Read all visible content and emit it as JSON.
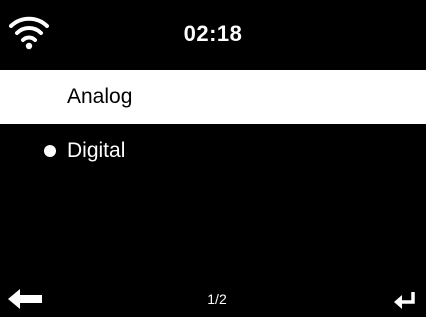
{
  "status_bar": {
    "time": "02:18",
    "wifi_icon": "wifi-icon"
  },
  "menu": {
    "items": [
      {
        "label": "Analog",
        "selected": true
      },
      {
        "label": "Digital",
        "selected": false,
        "radio_marked": true
      }
    ]
  },
  "footer": {
    "page": "1/2",
    "back_icon": "back-arrow-icon",
    "enter_icon": "enter-icon"
  },
  "colors": {
    "background": "#000000",
    "foreground": "#ffffff",
    "highlight_bg": "#ffffff",
    "highlight_fg": "#000000"
  }
}
